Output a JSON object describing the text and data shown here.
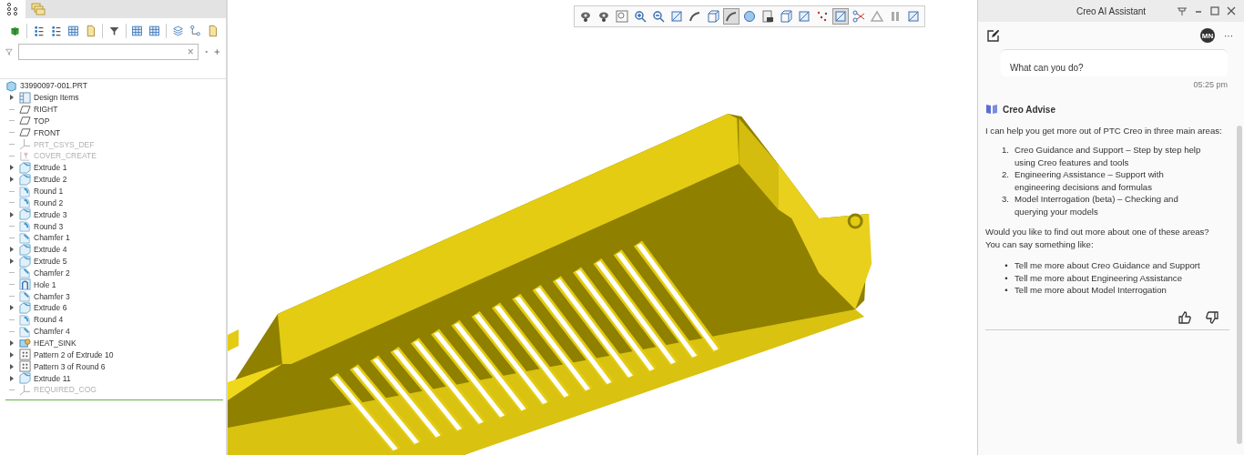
{
  "left_panel": {
    "tabs": [
      {
        "kind": "tree",
        "selected": true
      },
      {
        "kind": "layers",
        "selected": false
      }
    ],
    "toolbar": [
      {
        "kind": "cube"
      },
      {
        "kind": "list"
      },
      {
        "kind": "list"
      },
      {
        "kind": "table"
      },
      {
        "kind": "doc"
      },
      {
        "kind": "filter"
      },
      {
        "kind": "table"
      },
      {
        "kind": "table"
      },
      {
        "kind": "layers"
      },
      {
        "kind": "tree"
      },
      {
        "kind": "doc"
      }
    ],
    "search": {
      "clear": "×"
    },
    "tree": {
      "root": "33990097-001.PRT",
      "items": [
        {
          "label": "Design Items",
          "kind": "folder",
          "expandable": true,
          "dimmed": false
        },
        {
          "label": "RIGHT",
          "kind": "plane",
          "expandable": false,
          "dimmed": false
        },
        {
          "label": "TOP",
          "kind": "plane",
          "expandable": false,
          "dimmed": false
        },
        {
          "label": "FRONT",
          "kind": "plane",
          "expandable": false,
          "dimmed": false
        },
        {
          "label": "PRT_CSYS_DEF",
          "kind": "csys",
          "expandable": false,
          "dimmed": true
        },
        {
          "label": "COVER_CREATE",
          "kind": "feature",
          "expandable": false,
          "dimmed": true
        },
        {
          "label": "Extrude 1",
          "kind": "extrude",
          "expandable": true,
          "dimmed": false
        },
        {
          "label": "Extrude 2",
          "kind": "extrude",
          "expandable": true,
          "dimmed": false
        },
        {
          "label": "Round 1",
          "kind": "round",
          "expandable": false,
          "dimmed": false
        },
        {
          "label": "Round 2",
          "kind": "round",
          "expandable": false,
          "dimmed": false
        },
        {
          "label": "Extrude 3",
          "kind": "extrude",
          "expandable": true,
          "dimmed": false
        },
        {
          "label": "Round 3",
          "kind": "round",
          "expandable": false,
          "dimmed": false
        },
        {
          "label": "Chamfer 1",
          "kind": "chamfer",
          "expandable": false,
          "dimmed": false
        },
        {
          "label": "Extrude 4",
          "kind": "extrude",
          "expandable": true,
          "dimmed": false
        },
        {
          "label": "Extrude 5",
          "kind": "extrude",
          "expandable": true,
          "dimmed": false
        },
        {
          "label": "Chamfer 2",
          "kind": "chamfer",
          "expandable": false,
          "dimmed": false
        },
        {
          "label": "Hole 1",
          "kind": "hole",
          "expandable": false,
          "dimmed": false
        },
        {
          "label": "Chamfer 3",
          "kind": "chamfer",
          "expandable": false,
          "dimmed": false
        },
        {
          "label": "Extrude 6",
          "kind": "extrude",
          "expandable": true,
          "dimmed": false
        },
        {
          "label": "Round 4",
          "kind": "round",
          "expandable": false,
          "dimmed": false
        },
        {
          "label": "Chamfer 4",
          "kind": "chamfer",
          "expandable": false,
          "dimmed": false
        },
        {
          "label": "HEAT_SINK",
          "kind": "group",
          "expandable": true,
          "dimmed": false
        },
        {
          "label": "Pattern 2 of Extrude 10",
          "kind": "pattern",
          "expandable": true,
          "dimmed": false
        },
        {
          "label": "Pattern 3 of Round 6",
          "kind": "pattern",
          "expandable": true,
          "dimmed": false
        },
        {
          "label": "Extrude 11",
          "kind": "extrude",
          "expandable": true,
          "dimmed": false
        },
        {
          "label": "REQUIRED_COG",
          "kind": "csys",
          "expandable": false,
          "dimmed": true
        }
      ]
    }
  },
  "view_toolbar": [
    {
      "kind": "eye",
      "pressed": false
    },
    {
      "kind": "eye",
      "pressed": false
    },
    {
      "kind": "zoom-box",
      "pressed": false
    },
    {
      "kind": "zoom-in",
      "pressed": false
    },
    {
      "kind": "zoom-out",
      "pressed": false
    },
    {
      "kind": "square",
      "pressed": false
    },
    {
      "kind": "curve",
      "pressed": false
    },
    {
      "kind": "cube",
      "pressed": false
    },
    {
      "kind": "curve",
      "pressed": true
    },
    {
      "kind": "sphere",
      "pressed": false
    },
    {
      "kind": "camera",
      "pressed": false
    },
    {
      "kind": "cube",
      "pressed": false
    },
    {
      "kind": "square",
      "pressed": false
    },
    {
      "kind": "points",
      "pressed": false
    },
    {
      "kind": "square",
      "pressed": true
    },
    {
      "kind": "scissors",
      "pressed": false
    },
    {
      "kind": "triangle",
      "pressed": false
    },
    {
      "kind": "pause",
      "pressed": false
    },
    {
      "kind": "square",
      "pressed": false
    }
  ],
  "assistant": {
    "title": "Creo AI Assistant",
    "avatar": "MN",
    "more": "···",
    "user_message": {
      "text": "What can you do?",
      "time": "05:25 pm"
    },
    "reply": {
      "source": "Creo Advise",
      "intro": "I can help you get more out of PTC Creo in three main areas:",
      "areas": [
        {
          "marker": "1.",
          "text": "Creo Guidance and Support – Step by step help using Creo features and tools"
        },
        {
          "marker": "2.",
          "text": "Engineering Assistance – Support with engineering decisions and formulas"
        },
        {
          "marker": "3.",
          "text": "Model Interrogation (beta) – Checking and querying your models"
        }
      ],
      "question": [
        "Would you like to find out more about one of these areas?",
        "You can say something like:"
      ],
      "suggestions": [
        {
          "marker": "•",
          "text": "Tell me more about Creo Guidance and Support"
        },
        {
          "marker": "•",
          "text": "Tell me more about Engineering Assistance"
        },
        {
          "marker": "•",
          "text": "Tell me more about Model Interrogation"
        }
      ]
    }
  }
}
